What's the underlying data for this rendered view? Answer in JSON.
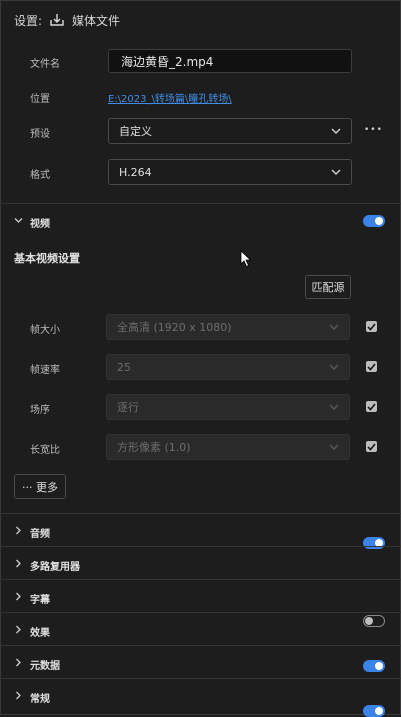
{
  "header": {
    "label": "设置:",
    "icon": "export-icon",
    "media_file": "媒体文件"
  },
  "file_name": {
    "label": "文件名",
    "value": "海边黄昏_2.mp4"
  },
  "location": {
    "label": "位置",
    "path": "E:\\2023_\\转场篇\\瞳孔转场\\"
  },
  "preset": {
    "label": "预设",
    "value": "自定义",
    "more": "•••"
  },
  "format": {
    "label": "格式",
    "value": "H.264"
  },
  "video": {
    "title": "视频",
    "enabled": true,
    "basic_title": "基本视频设置",
    "match_source": "匹配源",
    "frame_size": {
      "label": "帧大小",
      "value": "全高清 (1920 x 1080)"
    },
    "frame_rate": {
      "label": "帧速率",
      "value": "25"
    },
    "field_order": {
      "label": "场序",
      "value": "逐行"
    },
    "aspect": {
      "label": "长宽比",
      "value": "方形像素 (1.0)"
    },
    "more": "··· 更多"
  },
  "sections": [
    {
      "title": "音频",
      "toggle": "on"
    },
    {
      "title": "多路复用器",
      "toggle": "none"
    },
    {
      "title": "字幕",
      "toggle": "off"
    },
    {
      "title": "效果",
      "toggle": "on"
    },
    {
      "title": "元数据",
      "toggle": "on"
    },
    {
      "title": "常规",
      "toggle": "none"
    }
  ],
  "colors": {
    "accent": "#3b83e6",
    "link": "#3f8de6",
    "background": "#1d1d1d"
  }
}
